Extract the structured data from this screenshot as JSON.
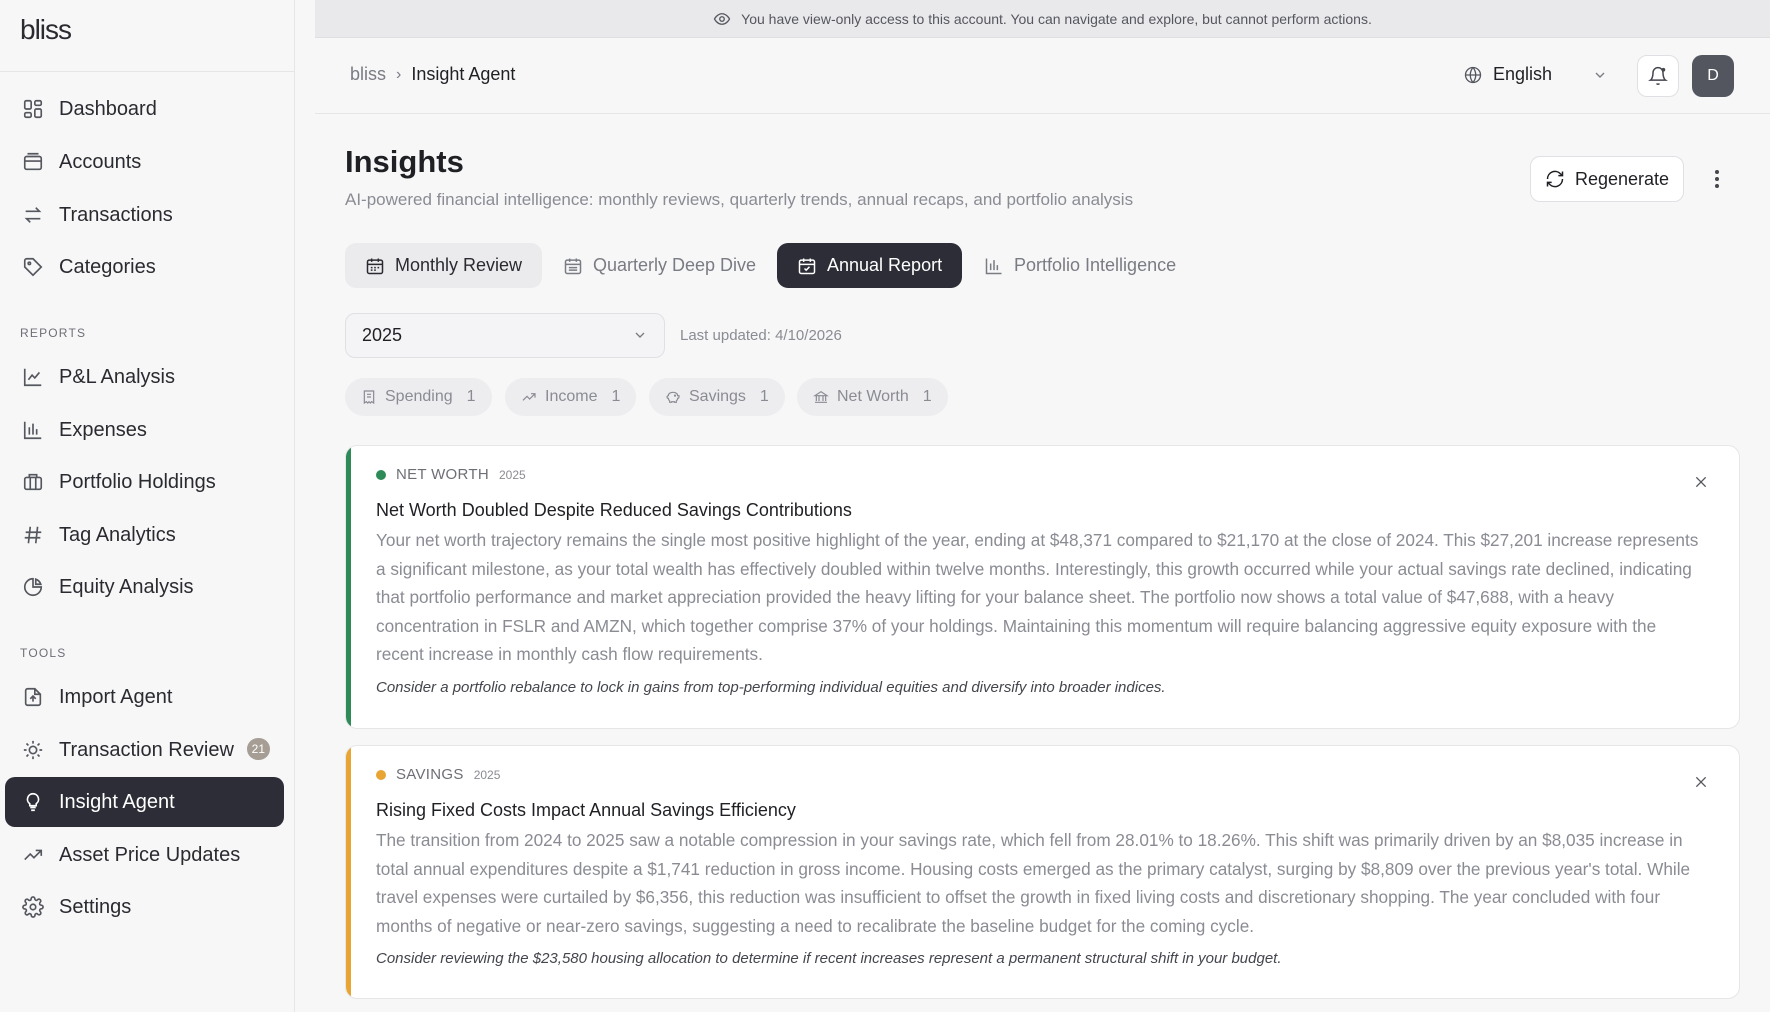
{
  "app": {
    "logo": "bliss"
  },
  "sidebar": {
    "items": [
      {
        "label": "Dashboard",
        "icon": "dashboard-icon"
      },
      {
        "label": "Accounts",
        "icon": "accounts-icon"
      },
      {
        "label": "Transactions",
        "icon": "transfer-arrows-icon"
      },
      {
        "label": "Categories",
        "icon": "tags-icon"
      }
    ],
    "reports_label": "REPORTS",
    "reports": [
      {
        "label": "P&L Analysis",
        "icon": "line-chart-icon"
      },
      {
        "label": "Expenses",
        "icon": "bar-chart-icon"
      },
      {
        "label": "Portfolio Holdings",
        "icon": "briefcase-icon"
      },
      {
        "label": "Tag Analytics",
        "icon": "hash-icon"
      },
      {
        "label": "Equity Analysis",
        "icon": "pie-chart-icon"
      }
    ],
    "tools_label": "TOOLS",
    "tools": [
      {
        "label": "Import Agent",
        "icon": "file-upload-icon"
      },
      {
        "label": "Transaction Review",
        "icon": "sun-icon",
        "badge": "21"
      },
      {
        "label": "Insight Agent",
        "icon": "lightbulb-icon",
        "active": true
      },
      {
        "label": "Asset Price Updates",
        "icon": "trending-up-icon"
      },
      {
        "label": "Settings",
        "icon": "gear-icon"
      }
    ]
  },
  "banner": {
    "text": "You have view-only access to this account. You can navigate and explore, but cannot perform actions."
  },
  "header": {
    "breadcrumb_root": "bliss",
    "breadcrumb_current": "Insight Agent",
    "language": "English",
    "avatar_initial": "D"
  },
  "main": {
    "title": "Insights",
    "subtitle": "AI-powered financial intelligence: monthly reviews, quarterly trends, annual recaps, and portfolio analysis",
    "regenerate_label": "Regenerate",
    "tabs": [
      {
        "label": "Monthly Review",
        "state": "light"
      },
      {
        "label": "Quarterly Deep Dive",
        "state": "plain"
      },
      {
        "label": "Annual Report",
        "state": "selected"
      },
      {
        "label": "Portfolio Intelligence",
        "state": "plain"
      }
    ],
    "year_selected": "2025",
    "last_updated": "Last updated: 4/10/2026",
    "filters": [
      {
        "label": "Spending",
        "count": "1"
      },
      {
        "label": "Income",
        "count": "1"
      },
      {
        "label": "Savings",
        "count": "1"
      },
      {
        "label": "Net Worth",
        "count": "1"
      }
    ],
    "insights": [
      {
        "category": "NET WORTH",
        "year": "2025",
        "color": "#2e8b57",
        "title": "Net Worth Doubled Despite Reduced Savings Contributions",
        "body": "Your net worth trajectory remains the single most positive highlight of the year, ending at $48,371 compared to $21,170 at the close of 2024. This $27,201 increase represents a significant milestone, as your total wealth has effectively doubled within twelve months. Interestingly, this growth occurred while your actual savings rate declined, indicating that portfolio performance and market appreciation provided the heavy lifting for your balance sheet. The portfolio now shows a total value of $47,688, with a heavy concentration in FSLR and AMZN, which together comprise 37% of your holdings. Maintaining this momentum will require balancing aggressive equity exposure with the recent increase in monthly cash flow requirements.",
        "recommendation": "Consider a portfolio rebalance to lock in gains from top-performing individual equities and diversify into broader indices."
      },
      {
        "category": "SAVINGS",
        "year": "2025",
        "color": "#e8a534",
        "title": "Rising Fixed Costs Impact Annual Savings Efficiency",
        "body": "The transition from 2024 to 2025 saw a notable compression in your savings rate, which fell from 28.01% to 18.26%. This shift was primarily driven by an $8,035 increase in total annual expenditures despite a $1,741 reduction in gross income. Housing costs emerged as the primary catalyst, surging by $8,809 over the previous year's total. While travel expenses were curtailed by $6,356, this reduction was insufficient to offset the growth in fixed living costs and discretionary shopping. The year concluded with four months of negative or near-zero savings, suggesting a need to recalibrate the baseline budget for the coming cycle.",
        "recommendation": "Consider reviewing the $23,580 housing allocation to determine if recent increases represent a permanent structural shift in your budget."
      }
    ]
  }
}
